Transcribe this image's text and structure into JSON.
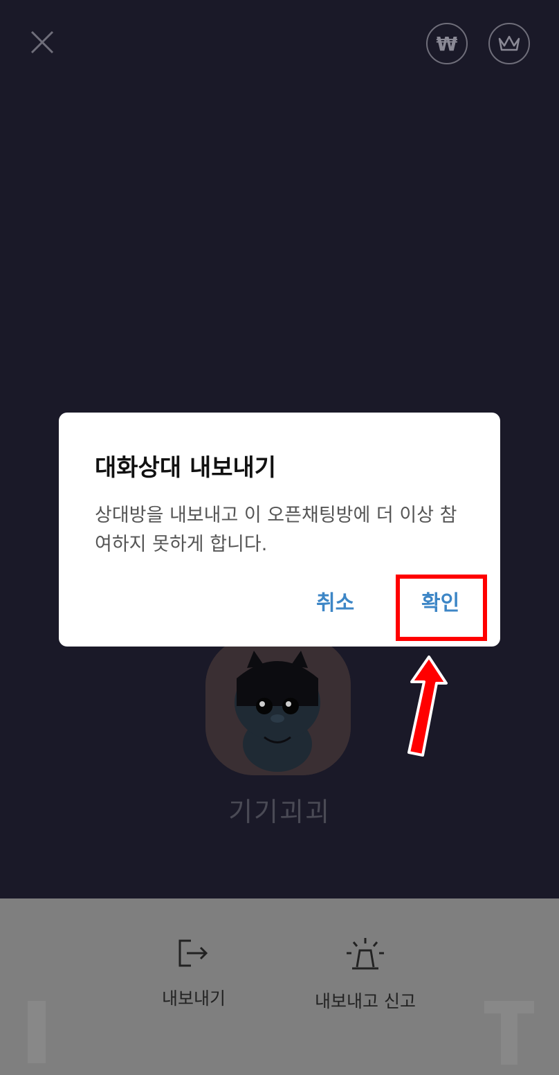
{
  "topbar": {
    "close_icon": "close-icon",
    "coin_symbol": "₩",
    "coin_icon": "won-coin-icon",
    "crown_icon": "crown-icon"
  },
  "profile": {
    "name": "기기괴괴"
  },
  "bottom_sheet": {
    "actions": [
      {
        "label": "내보내기",
        "icon": "exit-icon"
      },
      {
        "label": "내보내고 신고",
        "icon": "siren-icon"
      }
    ]
  },
  "dialog": {
    "title": "대화상대 내보내기",
    "message": "상대방을 내보내고 이 오픈채팅방에 더 이상 참여하지 못하게 합니다.",
    "cancel_label": "취소",
    "confirm_label": "확인"
  },
  "annotation": {
    "highlight_color": "#ff0000"
  }
}
